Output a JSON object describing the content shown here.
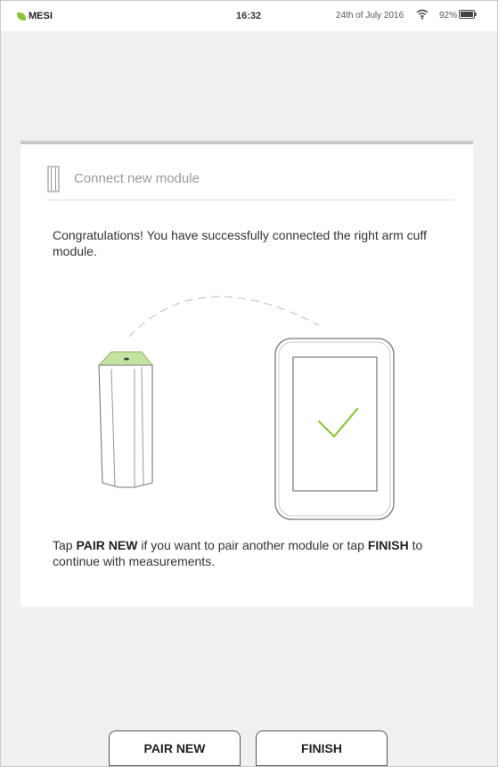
{
  "status_bar": {
    "carrier": "MESI",
    "time": "16:32",
    "date": "24th of July 2016",
    "battery": "92%",
    "icons": [
      "leaf-logo-icon",
      "wifi-icon",
      "battery-icon"
    ]
  },
  "card": {
    "title": "Connect new module",
    "message": "Congratulations! You have successfully connected the right arm cuff module.",
    "hint": {
      "part1": "Tap ",
      "pair_keyword": "PAIR NEW",
      "part2": " if you want to pair another module or tap ",
      "finish_keyword": "FINISH",
      "part3": " to continue with measurements."
    }
  },
  "buttons": {
    "pair_new": "PAIR NEW",
    "finish": "FINISH"
  },
  "colors": {
    "accent_green": "#8cc63f",
    "background": "#eff0f0",
    "card_border": "#c6cbc8"
  }
}
